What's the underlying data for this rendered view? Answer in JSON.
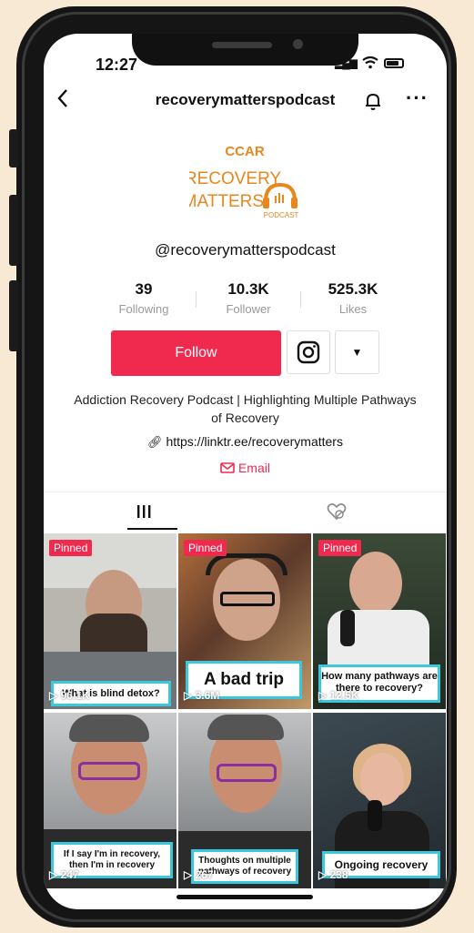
{
  "status_bar": {
    "time": "12:27"
  },
  "header": {
    "title": "recoverymatterspodcast",
    "back_icon": "chevron-left-icon",
    "bell_icon": "bell-icon",
    "more_icon": "more-icon"
  },
  "logo": {
    "top": "CCAR",
    "line1": "RECOVERY",
    "line2": "MATTERS!",
    "badge": "PODCAST"
  },
  "profile": {
    "username": "@recoverymatterspodcast",
    "stats": [
      {
        "value": "39",
        "label": "Following"
      },
      {
        "value": "10.3K",
        "label": "Follower"
      },
      {
        "value": "525.3K",
        "label": "Likes"
      }
    ],
    "follow_label": "Follow",
    "bio": "Addiction Recovery Podcast | Highlighting Multiple Pathways of Recovery",
    "link": "https://linktr.ee/recoverymatters",
    "email_label": "Email"
  },
  "colors": {
    "accent": "#f0294f",
    "caption_border": "#3bc8dd"
  },
  "videos": [
    {
      "pinned": "Pinned",
      "caption": "What is blind detox?",
      "views": "96.1K"
    },
    {
      "pinned": "Pinned",
      "caption": "A bad trip",
      "views": "3.6M"
    },
    {
      "pinned": "Pinned",
      "caption": "How many pathways are there to recovery?",
      "views": "12.5K"
    },
    {
      "pinned": "",
      "caption": "If I say I'm in recovery, then I'm in recovery",
      "views": "247"
    },
    {
      "pinned": "",
      "caption": "Thoughts on multiple pathways of recovery",
      "views": "267"
    },
    {
      "pinned": "",
      "caption": "Ongoing recovery",
      "views": "238"
    }
  ]
}
